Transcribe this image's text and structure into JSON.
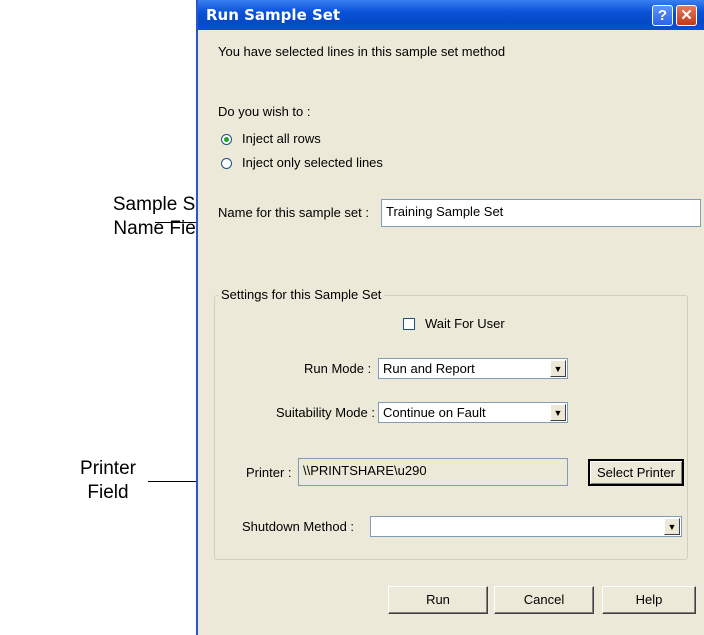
{
  "callouts": {
    "sample_set_name": [
      "Sample Set",
      "Name Field"
    ],
    "printer": [
      "Printer",
      "Field"
    ]
  },
  "dialog": {
    "title": "Run Sample Set",
    "help_button": "?",
    "close_button": "✕",
    "intro_text": "You have selected lines in this sample set method",
    "question": "Do you wish to :",
    "radio_all": "Inject all rows",
    "radio_selected": "Inject only selected lines",
    "radio_selected_value": "all",
    "name_label": "Name for this sample set :",
    "name_value": "Training Sample Set",
    "group_title": "Settings for this Sample Set",
    "wait_for_user": "Wait For User",
    "wait_for_user_checked": false,
    "run_mode_label": "Run Mode :",
    "run_mode_value": "Run and Report",
    "suitability_label": "Suitability Mode :",
    "suitability_value": "Continue on Fault",
    "printer_label": "Printer :",
    "printer_value": "\\\\PRINTSHARE\\u290",
    "select_printer": "Select Printer",
    "shutdown_label": "Shutdown Method :",
    "shutdown_value": "",
    "run_button": "Run",
    "cancel_button": "Cancel",
    "help_label": "Help"
  },
  "icons": {
    "dropdown_arrow": "chevron-down-icon"
  },
  "colors": {
    "titlebar": "#0a52d8",
    "dialog_bg": "#ece9d8",
    "radio_dot": "#21a121"
  }
}
